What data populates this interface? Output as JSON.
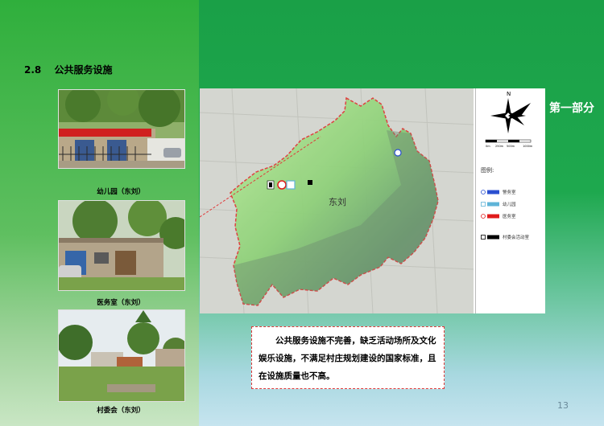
{
  "section": {
    "number": "2.8",
    "title": "公共服务设施"
  },
  "photos": [
    {
      "caption": "幼儿园（东刘）"
    },
    {
      "caption": "医务室（东刘）"
    },
    {
      "caption": "村委会（东刘）"
    }
  ],
  "map": {
    "village_label": "东刘",
    "legend_title": "图例:",
    "legend": [
      {
        "label": "警务室",
        "color": "#2a4fd0"
      },
      {
        "label": "幼儿园",
        "color": "#5fb4d8"
      },
      {
        "label": "医务室",
        "color": "#e01b1b"
      },
      {
        "label": "村委会活动室",
        "color": "#000000"
      }
    ],
    "scale_labels": [
      "0m",
      "250m",
      "500m",
      "1000m"
    ],
    "north_label": "N"
  },
  "part_label": "第一部分",
  "summary": "公共服务设施不完善，缺乏活动场所及文化娱乐设施，不满足村庄规划建设的国家标准，且在设施质量也不高。",
  "page_number": "13"
}
